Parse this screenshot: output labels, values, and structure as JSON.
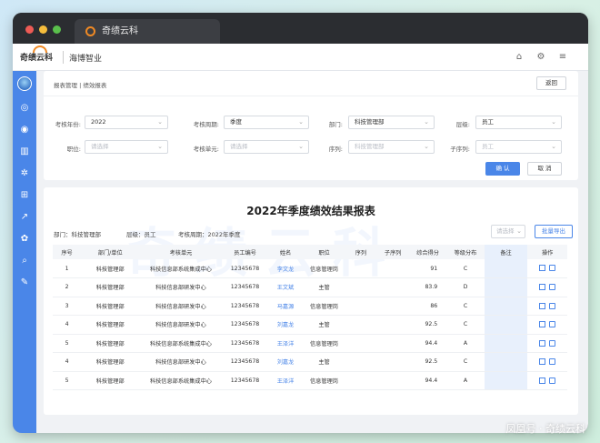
{
  "browser": {
    "tab_title": "奇绩云科"
  },
  "header": {
    "logo_text": "奇绩云科",
    "company": "海博智业"
  },
  "breadcrumb": "报表管理 | 绩效报表",
  "buttons": {
    "back": "返回",
    "confirm": "确 认",
    "cancel": "取 消",
    "export": "批量导出"
  },
  "filters": {
    "year": {
      "label": "考核年份:",
      "value": "2022"
    },
    "period": {
      "label": "考核周期:",
      "value": "季度"
    },
    "department": {
      "label": "部门:",
      "value": "科技管理部"
    },
    "level": {
      "label": "层级:",
      "value": "员工"
    },
    "position": {
      "label": "职位:",
      "placeholder": "请选择"
    },
    "unit": {
      "label": "考核单元:",
      "placeholder": "请选择"
    },
    "sequence": {
      "label": "序列:",
      "placeholder": "科技管理部"
    },
    "subsequence": {
      "label": "子序列:",
      "placeholder": "员工"
    }
  },
  "report": {
    "title": "2022年季度绩效结果报表",
    "meta_department": "部门：科技管理部",
    "meta_level": "层级：员工",
    "meta_period": "考核周期：2022年季度",
    "search_placeholder": "请选择",
    "watermark": "奇绩云科",
    "columns": [
      "序号",
      "部门/单位",
      "考核单元",
      "员工编号",
      "姓名",
      "职位",
      "序列",
      "子序列",
      "综合得分",
      "等级分布",
      "备注",
      "操作"
    ],
    "rows": [
      {
        "no": "1",
        "dept": "科技管理部",
        "unit": "科技信息部系统集成中心",
        "id": "12345678",
        "name": "李文龙",
        "position": "信息管理岗",
        "seq": "",
        "subseq": "",
        "score": "91",
        "grade": "C",
        "remark": ""
      },
      {
        "no": "2",
        "dept": "科技管理部",
        "unit": "科技信息部研发中心",
        "id": "12345678",
        "name": "王文斌",
        "position": "主管",
        "seq": "",
        "subseq": "",
        "score": "83.9",
        "grade": "D",
        "remark": ""
      },
      {
        "no": "3",
        "dept": "科技管理部",
        "unit": "科技信息部研发中心",
        "id": "12345678",
        "name": "马嘉源",
        "position": "信息管理岗",
        "seq": "",
        "subseq": "",
        "score": "86",
        "grade": "C",
        "remark": ""
      },
      {
        "no": "4",
        "dept": "科技管理部",
        "unit": "科技信息部研发中心",
        "id": "12345678",
        "name": "刘嘉龙",
        "position": "主管",
        "seq": "",
        "subseq": "",
        "score": "92.5",
        "grade": "C",
        "remark": ""
      },
      {
        "no": "5",
        "dept": "科技管理部",
        "unit": "科技信息部系统集成中心",
        "id": "12345678",
        "name": "王泽洋",
        "position": "信息管理岗",
        "seq": "",
        "subseq": "",
        "score": "94.4",
        "grade": "A",
        "remark": ""
      },
      {
        "no": "4",
        "dept": "科技管理部",
        "unit": "科技信息部研发中心",
        "id": "12345678",
        "name": "刘嘉龙",
        "position": "主管",
        "seq": "",
        "subseq": "",
        "score": "92.5",
        "grade": "C",
        "remark": ""
      },
      {
        "no": "5",
        "dept": "科技管理部",
        "unit": "科技信息部系统集成中心",
        "id": "12345678",
        "name": "王泽洋",
        "position": "信息管理岗",
        "seq": "",
        "subseq": "",
        "score": "94.4",
        "grade": "A",
        "remark": ""
      }
    ]
  },
  "caption": "凤凰号 · 奇绩云科",
  "colors": {
    "accent": "#4a86e8",
    "sidebar": "#4a86e8"
  }
}
